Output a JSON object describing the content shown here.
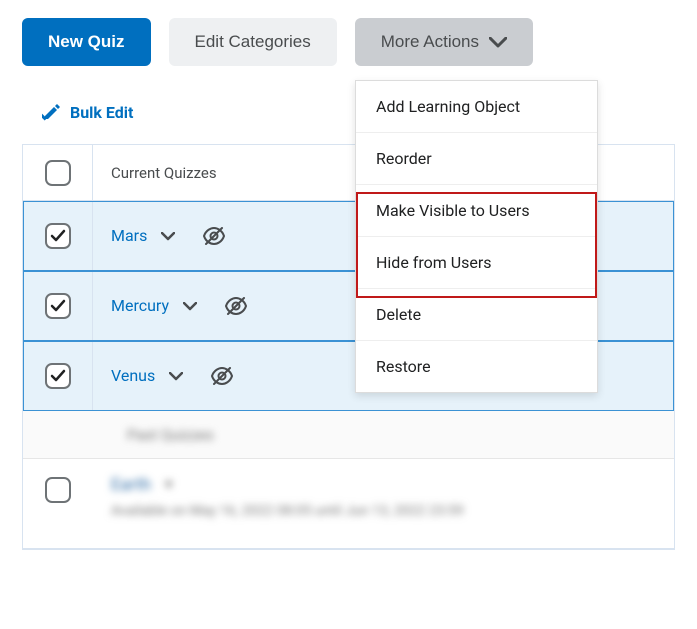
{
  "toolbar": {
    "new_quiz_label": "New Quiz",
    "edit_categories_label": "Edit Categories",
    "more_actions_label": "More Actions"
  },
  "bulk_edit_label": "Bulk Edit",
  "table": {
    "header_label": "Current Quizzes",
    "rows": [
      {
        "name": "Mars",
        "selected": true
      },
      {
        "name": "Mercury",
        "selected": true
      },
      {
        "name": "Venus",
        "selected": true
      }
    ],
    "section_label": "Past Quizzes",
    "blurred_row": {
      "name": "Earth",
      "subtitle": "Available on May 16, 2022 08:05 until Jun 13, 2022 23:59"
    }
  },
  "menu": {
    "items": [
      "Add Learning Object",
      "Reorder",
      "Make Visible to Users",
      "Hide from Users",
      "Delete",
      "Restore"
    ]
  }
}
